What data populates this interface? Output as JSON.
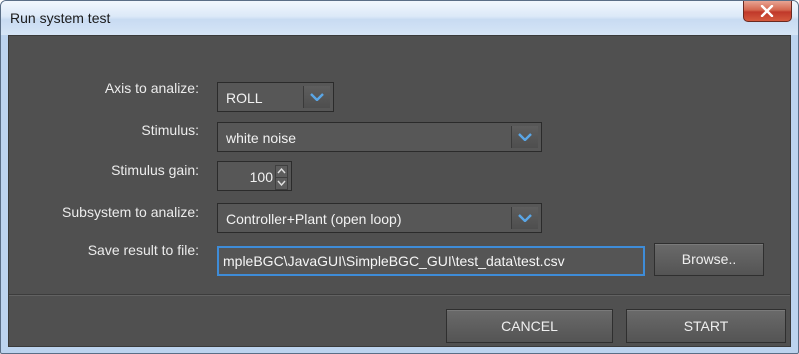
{
  "window": {
    "title": "Run system test"
  },
  "form": {
    "axis": {
      "label": "Axis to analize:",
      "value": "ROLL"
    },
    "stimulus": {
      "label": "Stimulus:",
      "value": "white noise"
    },
    "gain": {
      "label": "Stimulus gain:",
      "value": "100"
    },
    "subsystem": {
      "label": "Subsystem to analize:",
      "value": "Controller+Plant (open loop)"
    },
    "save_file": {
      "label": "Save result to file:",
      "value": "mpleBGC\\JavaGUI\\SimpleBGC_GUI\\test_data\\test.csv",
      "browse_label": "Browse.."
    }
  },
  "footer": {
    "cancel_label": "CANCEL",
    "start_label": "START"
  },
  "icons": {
    "close": "close-icon",
    "dropdown": "chevron-down-icon",
    "spinner_up": "chevron-up-icon",
    "spinner_down": "chevron-down-icon"
  },
  "colors": {
    "accent": "#3e8cd8",
    "dialog_background": "#505050",
    "close_button": "#c73a2b"
  }
}
